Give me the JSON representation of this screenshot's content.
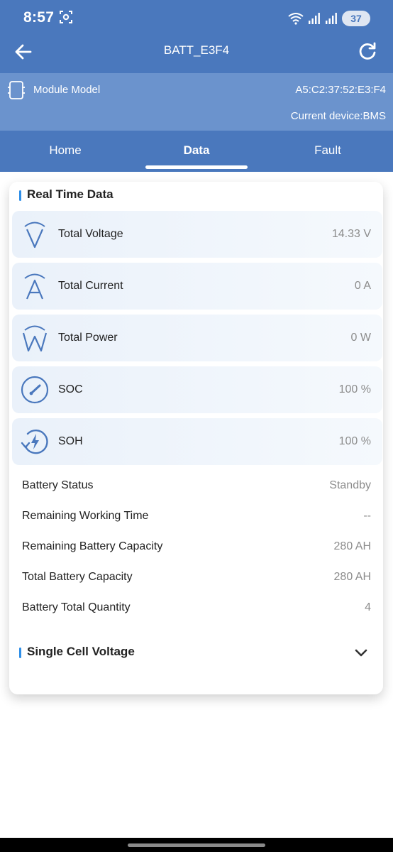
{
  "status_bar": {
    "time": "8:57",
    "battery_level": "37",
    "icons": [
      "screen-record-icon",
      "wifi-icon",
      "signal-icon",
      "signal-icon"
    ]
  },
  "app_bar": {
    "title": "BATT_E3F4",
    "back_icon": "arrow-left-icon",
    "refresh_icon": "refresh-icon"
  },
  "module": {
    "label": "Module Model",
    "mac": "A5:C2:37:52:E3:F4",
    "current_device": "Current device:BMS"
  },
  "tabs": [
    {
      "label": "Home",
      "active": false
    },
    {
      "label": "Data",
      "active": true
    },
    {
      "label": "Fault",
      "active": false
    }
  ],
  "real_time": {
    "title": "Real Time Data",
    "metrics": [
      {
        "icon": "voltage-icon",
        "label": "Total Voltage",
        "value": "14.33 V"
      },
      {
        "icon": "current-icon",
        "label": "Total Current",
        "value": "0 A"
      },
      {
        "icon": "power-icon",
        "label": "Total Power",
        "value": "0 W"
      },
      {
        "icon": "gauge-icon",
        "label": "SOC",
        "value": "100 %"
      },
      {
        "icon": "health-icon",
        "label": "SOH",
        "value": "100 %"
      }
    ],
    "info": [
      {
        "label": "Battery Status",
        "value": "Standby"
      },
      {
        "label": "Remaining Working Time",
        "value": "--"
      },
      {
        "label": "Remaining Battery Capacity",
        "value": "280 AH"
      },
      {
        "label": "Total Battery Capacity",
        "value": "280 AH"
      },
      {
        "label": "Battery Total Quantity",
        "value": "4"
      }
    ]
  },
  "single_cell": {
    "title": "Single Cell Voltage",
    "expanded": false
  },
  "colors": {
    "primary": "#4a78bd",
    "module_band": "#6b93cd",
    "accent_bar": "#2f8fe8",
    "metric_bg": "#eaf1fa",
    "value_grey": "#8c8c8c"
  }
}
